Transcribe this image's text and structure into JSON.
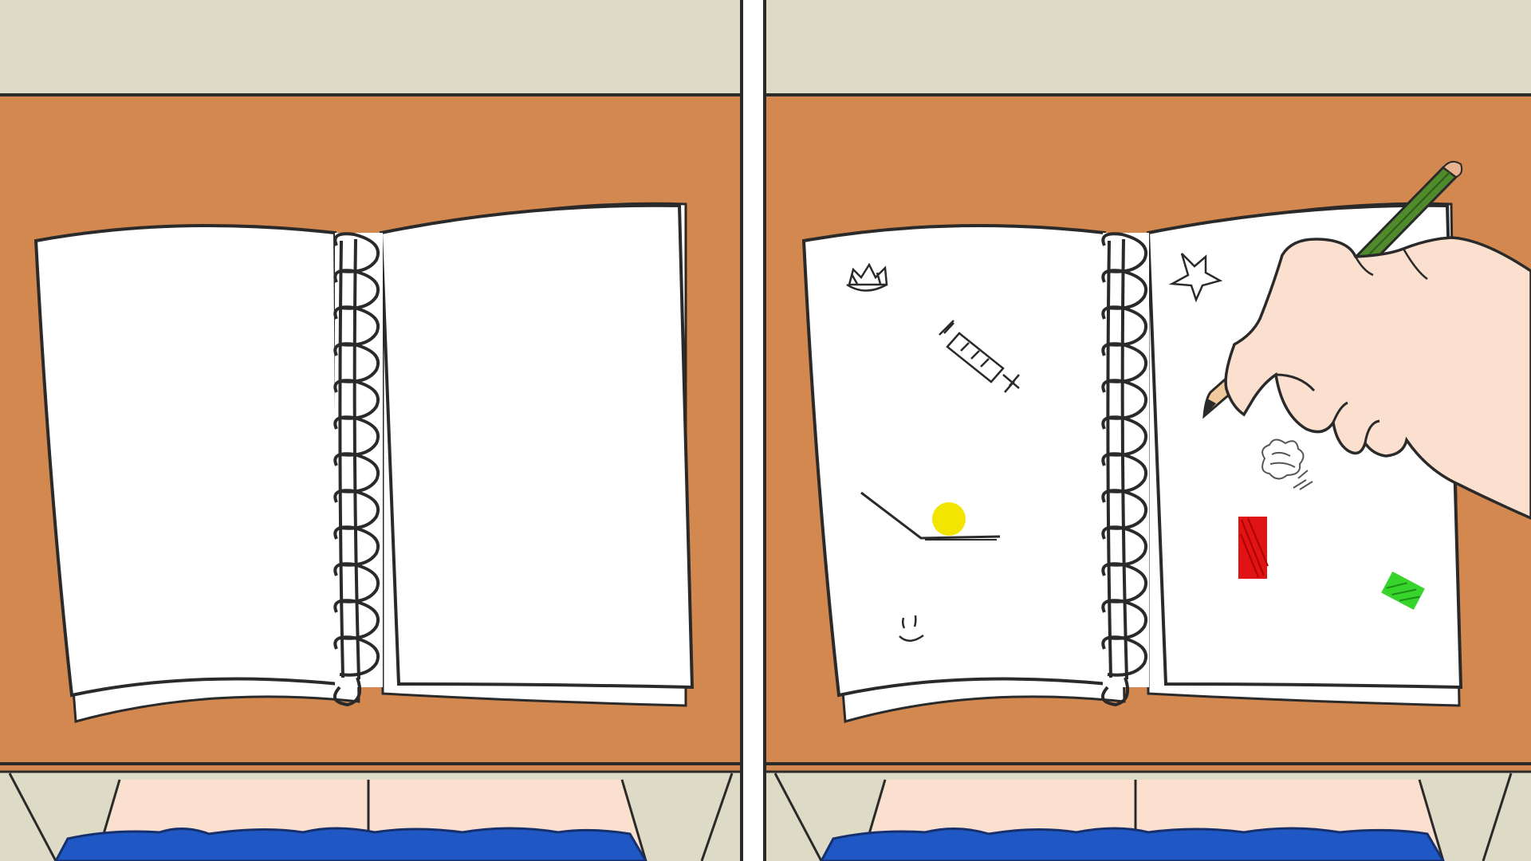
{
  "scene": {
    "panels": [
      {
        "state": "blank notebook"
      },
      {
        "state": "notebook with doodles, hand drawing"
      }
    ],
    "colors": {
      "wall": "#dddac6",
      "desk": "#d38850",
      "desk_outline": "#2b2b2b",
      "paper": "#ffffff",
      "ink": "#2a2a2a",
      "skin": "#fbe0cf",
      "skirt": "#1f58c4",
      "pencil": "#4f8a2b",
      "pencil_dark": "#2f5c19",
      "pencil_wood": "#f0c99c",
      "doodle_yellow": "#f2e600",
      "doodle_red": "#e01414",
      "doodle_green": "#37d52c",
      "divider": "#ffffff"
    },
    "doodles": [
      "crown-icon",
      "syringe-icon",
      "star-icon",
      "ramp-and-ball",
      "smiley-face",
      "cloud-scribble",
      "red-block",
      "green-block"
    ]
  }
}
